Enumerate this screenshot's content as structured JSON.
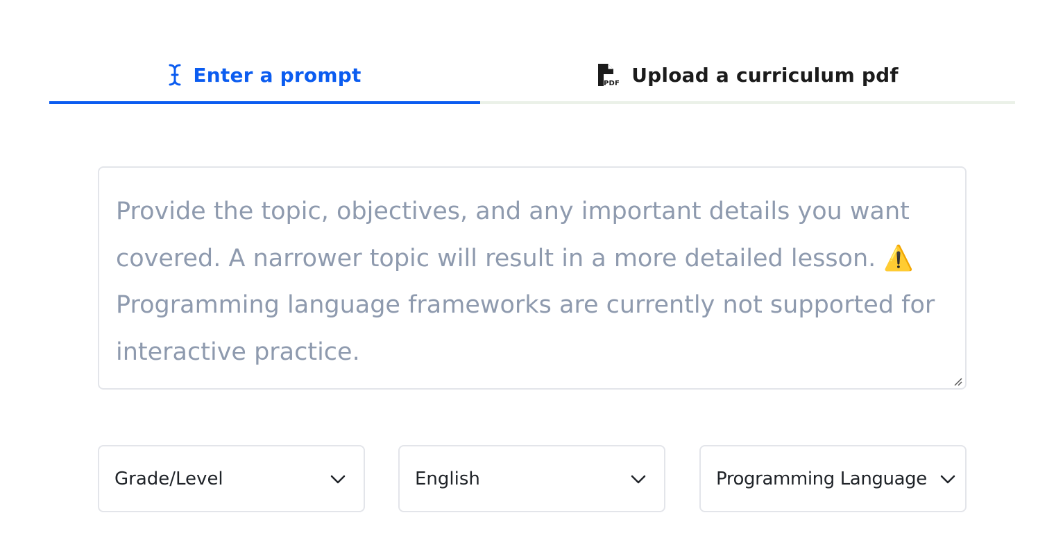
{
  "tabs": [
    {
      "label": "Enter a prompt",
      "icon": "text-cursor-icon",
      "active": true
    },
    {
      "label": "Upload a curriculum pdf",
      "icon": "pdf-file-icon",
      "active": false
    }
  ],
  "prompt": {
    "placeholder": "Provide the topic, objectives, and any important details you want covered. A narrower topic will result in a more detailed lesson. ⚠️ Programming language frameworks are currently not supported for interactive practice.",
    "value": ""
  },
  "selects": {
    "grade": {
      "value": "Grade/Level"
    },
    "language": {
      "value": "English"
    },
    "programming_language": {
      "value": "Programming Language"
    }
  },
  "colors": {
    "accent": "#0b5cf0",
    "placeholder": "#8e9aae",
    "border": "#e3e5ea",
    "tab_track": "#ebf1e8"
  }
}
